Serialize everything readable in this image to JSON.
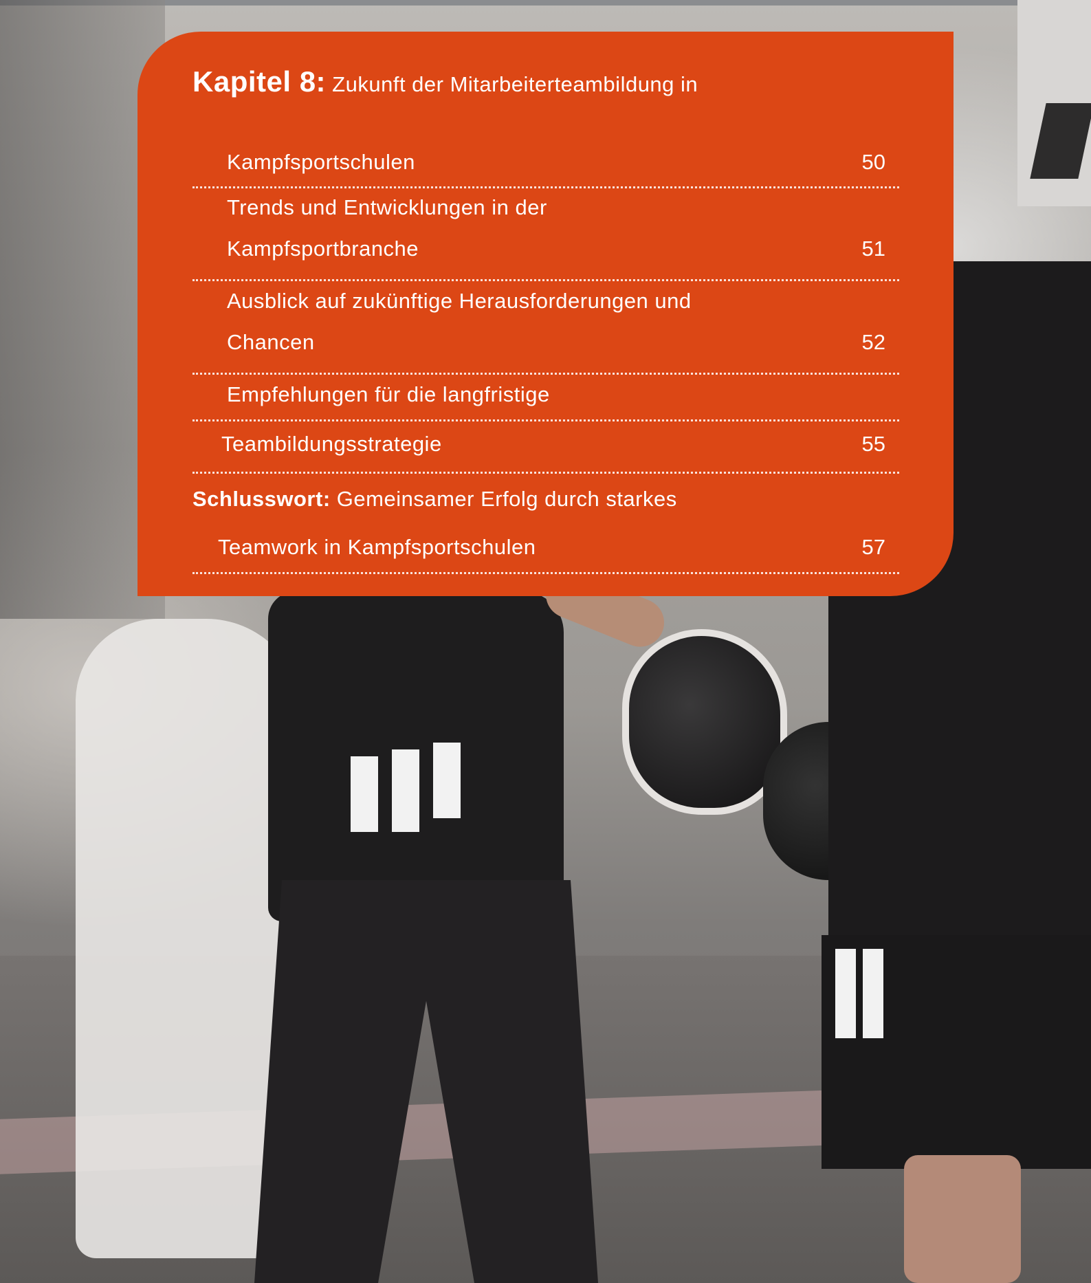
{
  "toc": {
    "chapter8": {
      "label": "Kapitel 8:",
      "title_line1": "Zukunft der Mitarbeiterteambildung in",
      "title_line2": "Kampfsportschulen",
      "page": "50"
    },
    "entries": [
      {
        "line1": "Trends und Entwicklungen in der",
        "line2": "Kampfsportbranche",
        "page": "51"
      },
      {
        "line1": "Ausblick auf zukünftige Herausforderungen und",
        "line2": "Chancen",
        "page": "52"
      },
      {
        "line1": "Empfehlungen für die langfristige",
        "line2": "Teambildungsstrategie",
        "page": "55"
      }
    ],
    "conclusion": {
      "label": "Schlusswort:",
      "title_line1": "Gemeinsamer Erfolg durch starkes",
      "title_line2": "Teamwork in Kampfsportschulen",
      "page": "57"
    }
  },
  "colors": {
    "panel": "#dc4715",
    "text": "#ffffff"
  }
}
